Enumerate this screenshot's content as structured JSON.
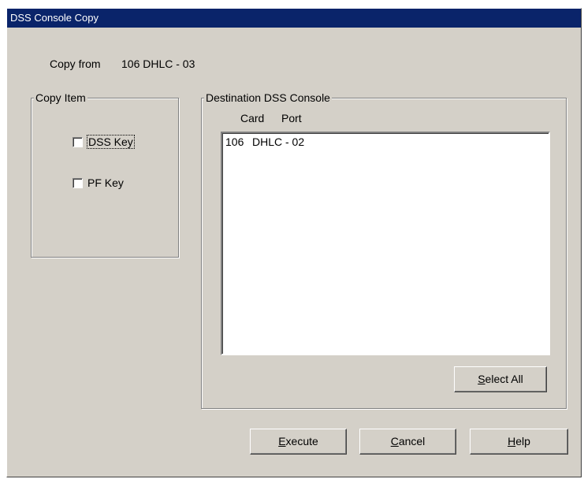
{
  "window": {
    "title": "DSS Console Copy"
  },
  "copy_from": {
    "label": "Copy from",
    "value": "106 DHLC - 03"
  },
  "copy_item": {
    "legend": "Copy Item",
    "options": [
      {
        "label": "DSS Key",
        "checked": false
      },
      {
        "label": "PF Key",
        "checked": false
      }
    ]
  },
  "destination": {
    "legend": "Destination DSS Console",
    "columns": [
      "Card",
      "Port"
    ],
    "rows": [
      {
        "card": "106",
        "port": "DHLC - 02"
      }
    ],
    "select_all": {
      "mnemonic": "S",
      "rest": "elect All"
    }
  },
  "buttons": {
    "execute": {
      "mnemonic": "E",
      "rest": "xecute"
    },
    "cancel": {
      "mnemonic": "C",
      "rest": "ancel"
    },
    "help": {
      "mnemonic": "H",
      "rest": "elp"
    }
  }
}
